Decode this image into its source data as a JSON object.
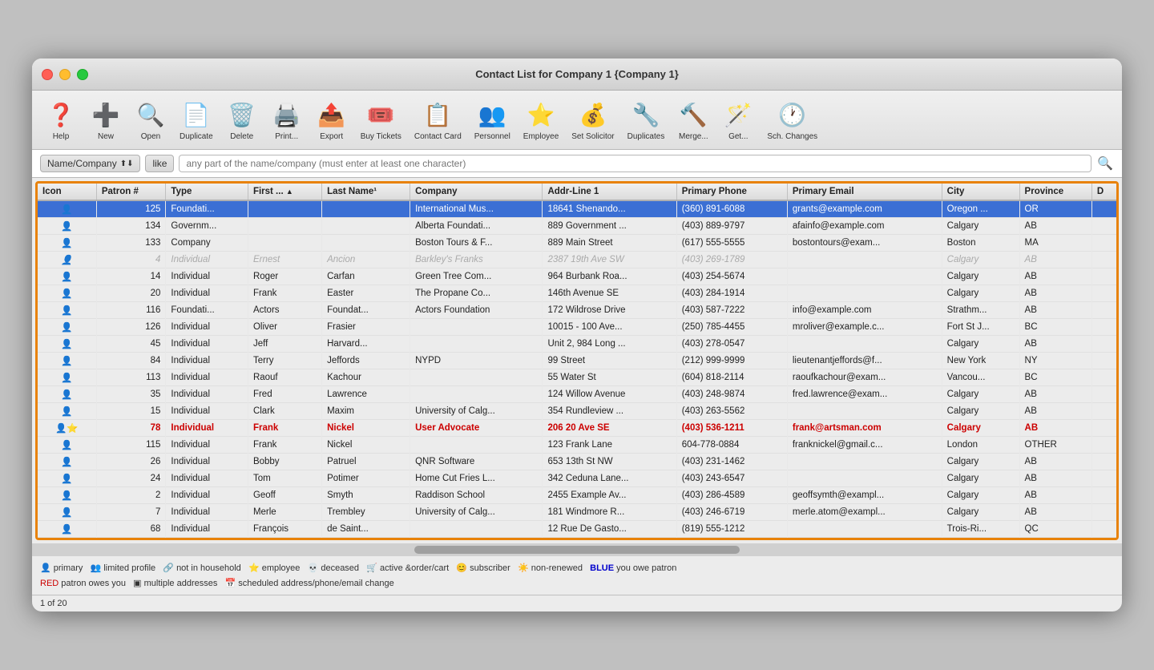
{
  "window": {
    "title": "Contact List for Company 1 {Company 1}"
  },
  "toolbar": {
    "buttons": [
      {
        "id": "help",
        "label": "Help",
        "icon": "❓"
      },
      {
        "id": "new",
        "label": "New",
        "icon": "➕"
      },
      {
        "id": "open",
        "label": "Open",
        "icon": "🔍"
      },
      {
        "id": "duplicate",
        "label": "Duplicate",
        "icon": "📄"
      },
      {
        "id": "delete",
        "label": "Delete",
        "icon": "🗑️"
      },
      {
        "id": "print",
        "label": "Print...",
        "icon": "🖨️"
      },
      {
        "id": "export",
        "label": "Export",
        "icon": "📤"
      },
      {
        "id": "buy-tickets",
        "label": "Buy Tickets",
        "icon": "🎟️"
      },
      {
        "id": "contact-card",
        "label": "Contact Card",
        "icon": "📋"
      },
      {
        "id": "personnel",
        "label": "Personnel",
        "icon": "👥"
      },
      {
        "id": "employee",
        "label": "Employee",
        "icon": "⭐"
      },
      {
        "id": "set-solicitor",
        "label": "Set Solicitor",
        "icon": "💰"
      },
      {
        "id": "duplicates",
        "label": "Duplicates",
        "icon": "🔧"
      },
      {
        "id": "merge",
        "label": "Merge...",
        "icon": "🔨"
      },
      {
        "id": "get",
        "label": "Get...",
        "icon": "🪄"
      },
      {
        "id": "sch-changes",
        "label": "Sch. Changes",
        "icon": "🕐"
      }
    ]
  },
  "search": {
    "field_label": "Name/Company",
    "operator": "like",
    "placeholder": "any part of the name/company (must enter at least one character)"
  },
  "table": {
    "columns": [
      {
        "id": "icon",
        "label": "Icon"
      },
      {
        "id": "patron",
        "label": "Patron #"
      },
      {
        "id": "type",
        "label": "Type"
      },
      {
        "id": "first",
        "label": "First ...",
        "sort": "asc"
      },
      {
        "id": "last",
        "label": "Last Name¹"
      },
      {
        "id": "company",
        "label": "Company"
      },
      {
        "id": "addr1",
        "label": "Addr-Line 1"
      },
      {
        "id": "phone",
        "label": "Primary Phone"
      },
      {
        "id": "email",
        "label": "Primary Email"
      },
      {
        "id": "city",
        "label": "City"
      },
      {
        "id": "province",
        "label": "Province"
      },
      {
        "id": "d",
        "label": "D"
      }
    ],
    "rows": [
      {
        "icon": "👤",
        "patron": "125",
        "type": "Foundati...",
        "first": "",
        "last": "",
        "company": "International Mus...",
        "addr1": "18641 Shenando...",
        "phone": "(360) 891-6088",
        "email": "grants@example.com",
        "city": "Oregon ...",
        "province": "OR",
        "d": "",
        "style": "selected"
      },
      {
        "icon": "👤",
        "patron": "134",
        "type": "Governm...",
        "first": "",
        "last": "",
        "company": "Alberta Foundati...",
        "addr1": "889 Government ...",
        "phone": "(403) 889-9797",
        "email": "afainfo@example.com",
        "city": "Calgary",
        "province": "AB",
        "d": "",
        "style": "normal"
      },
      {
        "icon": "👤",
        "patron": "133",
        "type": "Company",
        "first": "",
        "last": "",
        "company": "Boston Tours & F...",
        "addr1": "889 Main Street",
        "phone": "(617) 555-5555",
        "email": "bostontours@exam...",
        "city": "Boston",
        "province": "MA",
        "d": "",
        "style": "normal"
      },
      {
        "icon": "👤",
        "patron": "4",
        "type": "Individual",
        "first": "Ernest",
        "last": "Ancion",
        "company": "Barkley's Franks",
        "addr1": "2387 19th Ave SW",
        "phone": "(403) 269-1789",
        "email": "",
        "city": "Calgary",
        "province": "AB",
        "d": "",
        "style": "grayed"
      },
      {
        "icon": "👤",
        "patron": "14",
        "type": "Individual",
        "first": "Roger",
        "last": "Carfan",
        "company": "Green Tree Com...",
        "addr1": "964 Burbank Roa...",
        "phone": "(403) 254-5674",
        "email": "",
        "city": "Calgary",
        "province": "AB",
        "d": "",
        "style": "normal"
      },
      {
        "icon": "👤",
        "patron": "20",
        "type": "Individual",
        "first": "Frank",
        "last": "Easter",
        "company": "The Propane Co...",
        "addr1": "146th Avenue SE",
        "phone": "(403) 284-1914",
        "email": "",
        "city": "Calgary",
        "province": "AB",
        "d": "",
        "style": "normal"
      },
      {
        "icon": "👤",
        "patron": "116",
        "type": "Foundati...",
        "first": "Actors",
        "last": "Foundat...",
        "company": "Actors Foundation",
        "addr1": "172 Wildrose Drive",
        "phone": "(403) 587-7222",
        "email": "info@example.com",
        "city": "Strathm...",
        "province": "AB",
        "d": "",
        "style": "normal"
      },
      {
        "icon": "👤",
        "patron": "126",
        "type": "Individual",
        "first": "Oliver",
        "last": "Frasier",
        "company": "",
        "addr1": "10015 - 100 Ave...",
        "phone": "(250) 785-4455",
        "email": "mroliver@example.c...",
        "city": "Fort St J...",
        "province": "BC",
        "d": "",
        "style": "normal"
      },
      {
        "icon": "👤",
        "patron": "45",
        "type": "Individual",
        "first": "Jeff",
        "last": "Harvard...",
        "company": "",
        "addr1": "Unit 2, 984 Long ...",
        "phone": "(403) 278-0547",
        "email": "",
        "city": "Calgary",
        "province": "AB",
        "d": "",
        "style": "normal"
      },
      {
        "icon": "👤",
        "patron": "84",
        "type": "Individual",
        "first": "Terry",
        "last": "Jeffords",
        "company": "NYPD",
        "addr1": "99 Street",
        "phone": "(212) 999-9999",
        "email": "lieutenantjeffords@f...",
        "city": "New York",
        "province": "NY",
        "d": "",
        "style": "normal"
      },
      {
        "icon": "👤",
        "patron": "113",
        "type": "Individual",
        "first": "Raouf",
        "last": "Kachour",
        "company": "",
        "addr1": "55 Water St",
        "phone": "(604) 818-2114",
        "email": "raoufkachour@exam...",
        "city": "Vancou...",
        "province": "BC",
        "d": "",
        "style": "normal"
      },
      {
        "icon": "👤",
        "patron": "35",
        "type": "Individual",
        "first": "Fred",
        "last": "Lawrence",
        "company": "",
        "addr1": "124 Willow Avenue",
        "phone": "(403) 248-9874",
        "email": "fred.lawrence@exam...",
        "city": "Calgary",
        "province": "AB",
        "d": "",
        "style": "normal"
      },
      {
        "icon": "👤",
        "patron": "15",
        "type": "Individual",
        "first": "Clark",
        "last": "Maxim",
        "company": "University of Calg...",
        "addr1": "354 Rundleview ...",
        "phone": "(403) 263-5562",
        "email": "",
        "city": "Calgary",
        "province": "AB",
        "d": "",
        "style": "normal"
      },
      {
        "icon": "👤⭐",
        "patron": "78",
        "type": "Individual",
        "first": "Frank",
        "last": "Nickel",
        "company": "User Advocate",
        "addr1": "206 20 Ave SE",
        "phone": "(403) 536-1211",
        "email": "frank@artsman.com",
        "city": "Calgary",
        "province": "AB",
        "d": "",
        "style": "red-row"
      },
      {
        "icon": "👤",
        "patron": "115",
        "type": "Individual",
        "first": "Frank",
        "last": "Nickel",
        "company": "",
        "addr1": "123 Frank Lane",
        "phone": "604-778-0884",
        "email": "franknickel@gmail.c...",
        "city": "London",
        "province": "OTHER",
        "d": "",
        "style": "normal"
      },
      {
        "icon": "👤",
        "patron": "26",
        "type": "Individual",
        "first": "Bobby",
        "last": "Patruel",
        "company": "QNR Software",
        "addr1": "653 13th St NW",
        "phone": "(403) 231-1462",
        "email": "",
        "city": "Calgary",
        "province": "AB",
        "d": "",
        "style": "normal"
      },
      {
        "icon": "👤",
        "patron": "24",
        "type": "Individual",
        "first": "Tom",
        "last": "Potimer",
        "company": "Home Cut Fries L...",
        "addr1": "342 Ceduna Lane...",
        "phone": "(403) 243-6547",
        "email": "",
        "city": "Calgary",
        "province": "AB",
        "d": "",
        "style": "normal"
      },
      {
        "icon": "👤",
        "patron": "2",
        "type": "Individual",
        "first": "Geoff",
        "last": "Smyth",
        "company": "Raddison School",
        "addr1": "2455 Example Av...",
        "phone": "(403) 286-4589",
        "email": "geoffsymth@exampl...",
        "city": "Calgary",
        "province": "AB",
        "d": "",
        "style": "normal"
      },
      {
        "icon": "👤",
        "patron": "7",
        "type": "Individual",
        "first": "Merle",
        "last": "Trembley",
        "company": "University of Calg...",
        "addr1": "181 Windmore R...",
        "phone": "(403) 246-6719",
        "email": "merle.atom@exampl...",
        "city": "Calgary",
        "province": "AB",
        "d": "",
        "style": "normal"
      },
      {
        "icon": "👤",
        "patron": "68",
        "type": "Individual",
        "first": "François",
        "last": "de Saint...",
        "company": "",
        "addr1": "12 Rue De Gasto...",
        "phone": "(819) 555-1212",
        "email": "",
        "city": "Trois-Ri...",
        "province": "QC",
        "d": "",
        "style": "normal"
      }
    ]
  },
  "legend": {
    "items": [
      {
        "icon": "👤",
        "text": "primary"
      },
      {
        "icon": "👥",
        "text": "limited profile"
      },
      {
        "icon": "🔗",
        "text": "not in household"
      },
      {
        "icon": "⭐",
        "text": "employee"
      },
      {
        "icon": "💀",
        "text": "deceased"
      },
      {
        "icon": "🛒",
        "text": "active &order/cart"
      },
      {
        "icon": "😊",
        "text": "subscriber"
      },
      {
        "icon": "☀️",
        "text": "non-renewed"
      },
      {
        "text_blue": "BLUE",
        "text": "you owe patron"
      }
    ],
    "line2": "RED patron owes you    multiple addresses    scheduled address/phone/email change"
  },
  "status": {
    "text": "1 of 20"
  }
}
